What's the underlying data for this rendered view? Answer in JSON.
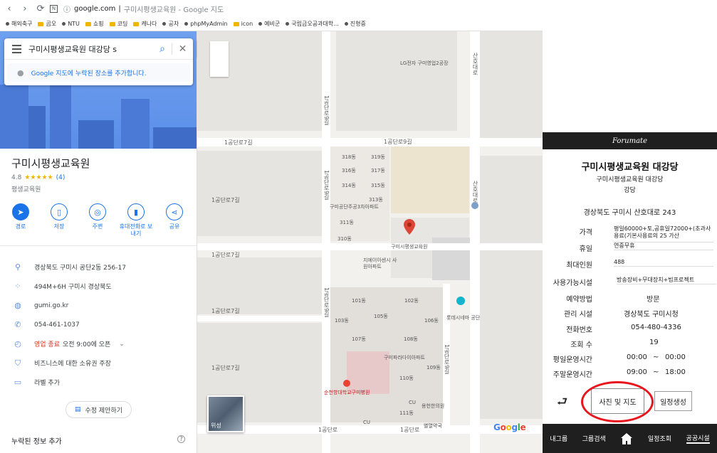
{
  "browser": {
    "url_host": "google.com",
    "tab_title": "구미시평생교육원 - Google 지도",
    "bookmarks": [
      "해외축구",
      "곰오",
      "NTU",
      "쇼핑",
      "코딩",
      "캐나다",
      "공차",
      "phpMyAdmin",
      "icon",
      "예비군",
      "국립금오공과대학...",
      "진형중"
    ]
  },
  "search": {
    "query": "구미시평생교육원 대강당 s",
    "add_place": "Google 지도에 누락된 장소를 추가합니다."
  },
  "place": {
    "name": "구미시평생교육원",
    "rating": "4.8",
    "stars": "★★★★★",
    "review_count": "(4)",
    "category": "평생교육원",
    "actions": [
      "경로",
      "저장",
      "주변",
      "휴대전화로 보\n내기",
      "공유"
    ],
    "info": {
      "address": "경상북도 구미시 공단2동 256-17",
      "pluscode": "494M+6H 구미시 경상북도",
      "website": "gumi.go.kr",
      "phone": "054-461-1037",
      "hours_status": "영업 종료",
      "hours_open": "오전 9:00에 오픈",
      "claim": "비즈니스에 대한 소유권 주장",
      "label": "라벨 추가"
    },
    "suggest_edit": "수정 제안하기",
    "missing_info": "누락된 정보 추가"
  },
  "map": {
    "roads": [
      "1공단로9길",
      "1공단로7길",
      "1공단로",
      "산호대로"
    ],
    "pin_label": "구미시평생교육원",
    "places": [
      "LG전자 구미영업2공장",
      "구미공단주공3차아파트",
      "지에이아센시 사원아파트",
      "구미파라다이아파트",
      "순천향대학교구미병원",
      "롯데시네마 공단",
      "용헌한의원",
      "별열약국"
    ],
    "buildings": [
      "318동",
      "319동",
      "316동",
      "317동",
      "314동",
      "315동",
      "313동",
      "311동",
      "310동",
      "101동",
      "102동",
      "103동",
      "105동",
      "106동",
      "107동",
      "108동",
      "109동",
      "110동",
      "111동"
    ],
    "store": "CU",
    "photo_label": "위성",
    "logo": "Google"
  },
  "app": {
    "header": "Forumate",
    "title": "구미시평생교육원 대강당",
    "sub1": "구미시평생교육원 대강당",
    "sub2": "강당",
    "address": "경상북도 구미시 산호대로 243",
    "labels": {
      "price": "가격",
      "holiday": "휴일",
      "max_people": "최대인원",
      "facilities": "사용가능시설",
      "reservation": "예약방법",
      "manager": "관리 시설",
      "phone": "전화번호",
      "views": "조회 수",
      "weekday": "평일운영시간",
      "weekend": "주말운영시간"
    },
    "values": {
      "price": "평일60000+토,공휴일72000+(초과사용료(기본사용료의 25 가산",
      "holiday": "연중무휴",
      "max_people": "488",
      "facilities": "방송장비+무대장치+빔프로젝트",
      "reservation": "방문",
      "manager": "경상북도 구미시청",
      "phone": "054-480-4336",
      "views": "19",
      "weekday_start": "00:00",
      "weekday_end": "00:00",
      "weekend_start": "09:00",
      "weekend_end": "18:00",
      "tilde": "~"
    },
    "photo_button": "사진 및 지도",
    "schedule_button": "일정생성",
    "tabs": [
      "내그룹",
      "그룹검색",
      "일정조회",
      "공공시설"
    ],
    "accent": "#e8161c"
  }
}
